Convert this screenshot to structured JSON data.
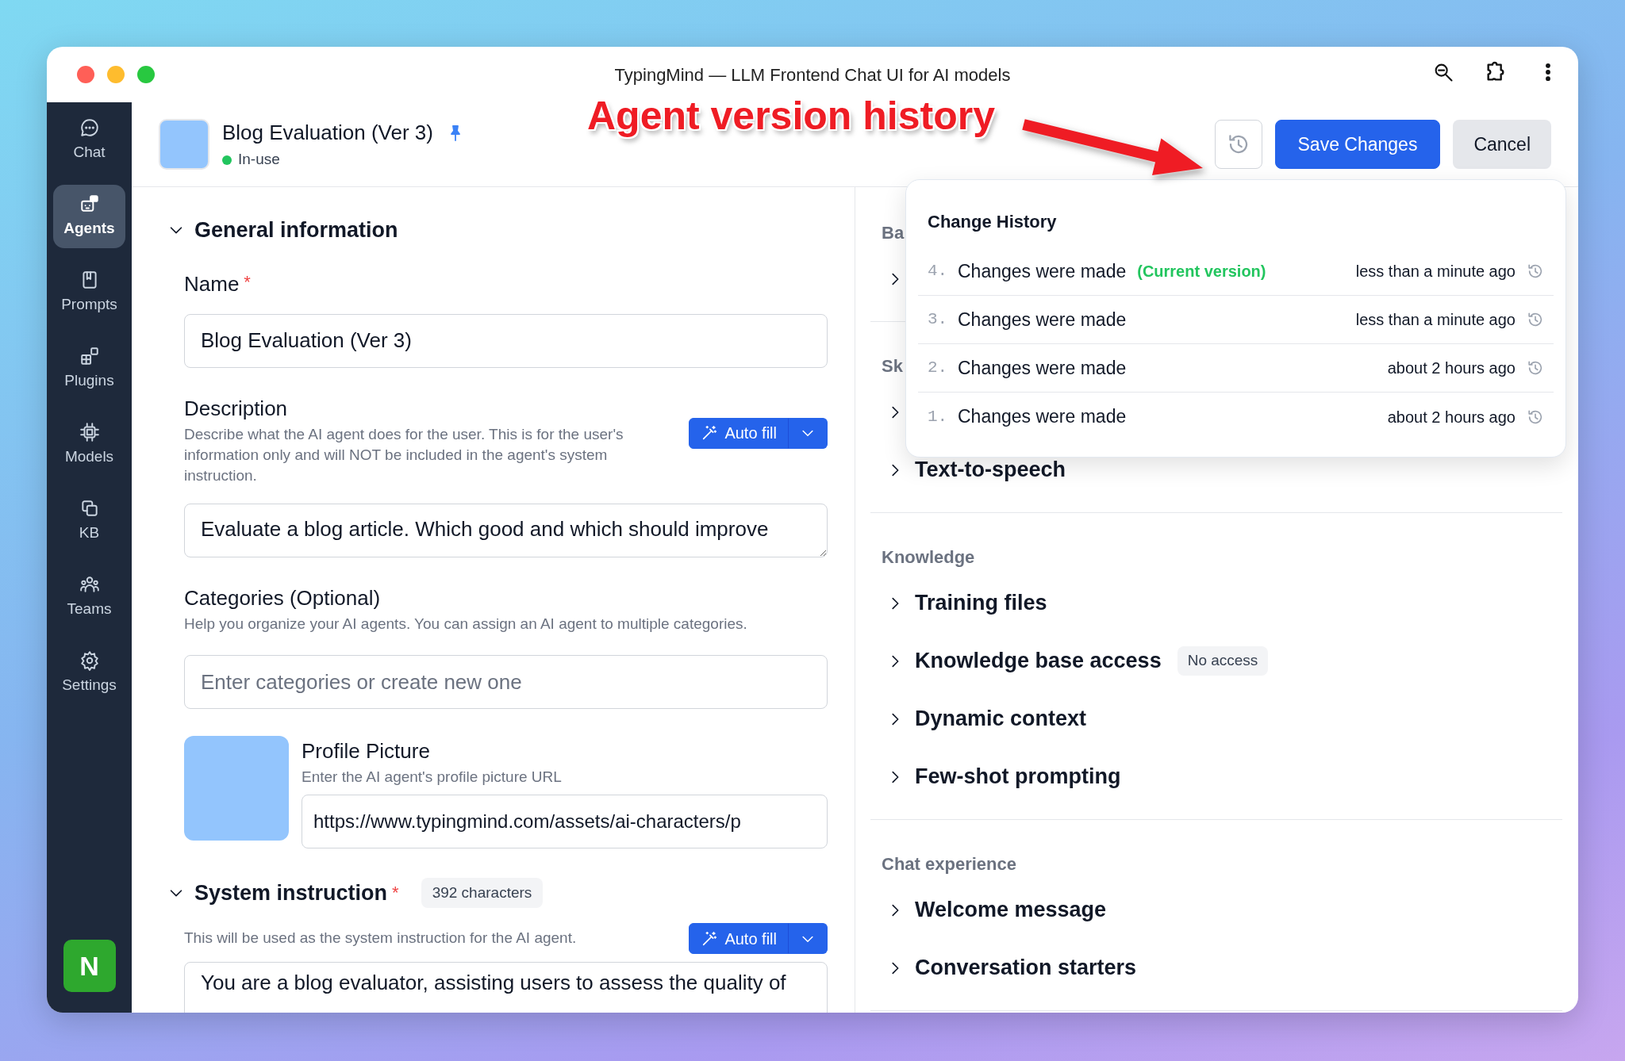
{
  "window": {
    "title": "TypingMind — LLM Frontend Chat UI for AI models"
  },
  "annotation": {
    "text": "Agent version history"
  },
  "sidebar": {
    "items": [
      {
        "label": "Chat",
        "selected": false
      },
      {
        "label": "Agents",
        "selected": true
      },
      {
        "label": "Prompts",
        "selected": false
      },
      {
        "label": "Plugins",
        "selected": false
      },
      {
        "label": "Models",
        "selected": false
      },
      {
        "label": "KB",
        "selected": false
      },
      {
        "label": "Teams",
        "selected": false
      },
      {
        "label": "Settings",
        "selected": false
      }
    ],
    "user_initial": "N"
  },
  "header": {
    "title": "Blog Evaluation (Ver 3)",
    "status": "In-use"
  },
  "actions": {
    "save": "Save Changes",
    "cancel": "Cancel"
  },
  "change_history": {
    "title": "Change History",
    "items": [
      {
        "number": "4.",
        "label": "Changes were made",
        "note": "(Current version)",
        "time": "less than a minute ago"
      },
      {
        "number": "3.",
        "label": "Changes were made",
        "time": "less than a minute ago"
      },
      {
        "number": "2.",
        "label": "Changes were made",
        "time": "about 2 hours ago"
      },
      {
        "number": "1.",
        "label": "Changes were made",
        "time": "about 2 hours ago"
      }
    ]
  },
  "form": {
    "general": {
      "title": "General information",
      "expanded": true
    },
    "name": {
      "label": "Name",
      "required_mark": "*",
      "value": "Blog Evaluation (Ver 3)"
    },
    "description": {
      "label": "Description",
      "help": "Describe what the AI agent does for the user. This is for the user's information only and will NOT be included in the agent's system instruction.",
      "autofill": "Auto fill",
      "value": "Evaluate a blog article. Which good and which should improve"
    },
    "categories": {
      "label": "Categories (Optional)",
      "help": "Help you organize your AI agents. You can assign an AI agent to multiple categories.",
      "placeholder": "Enter categories or create new one"
    },
    "profile_picture": {
      "label": "Profile Picture",
      "help": "Enter the AI agent's profile picture URL",
      "value": "https://www.typingmind.com/assets/ai-characters/p"
    },
    "system_instruction": {
      "title": "System instruction",
      "expanded": true,
      "required_mark": "*",
      "count": "392 characters",
      "help": "This will be used as the system instruction for the AI agent.",
      "autofill": "Auto fill",
      "value": "You are a blog evaluator, assisting users to assess the quality of"
    }
  },
  "right_panel": {
    "groups": [
      {
        "heading": "Ba",
        "items": [
          {
            "expanded": false
          }
        ]
      },
      {
        "heading": "Sk",
        "items": [
          {
            "expanded": false
          },
          {
            "label": "Text-to-speech",
            "expanded": false
          }
        ]
      },
      {
        "heading": "Knowledge",
        "items": [
          {
            "label": "Training files",
            "expanded": false
          },
          {
            "label": "Knowledge base access",
            "badge": "No access",
            "expanded": false
          },
          {
            "label": "Dynamic context",
            "expanded": false
          },
          {
            "label": "Few-shot prompting",
            "expanded": false
          }
        ]
      },
      {
        "heading": "Chat experience",
        "items": [
          {
            "label": "Welcome message",
            "expanded": false
          },
          {
            "label": "Conversation starters",
            "expanded": false
          }
        ]
      }
    ]
  }
}
